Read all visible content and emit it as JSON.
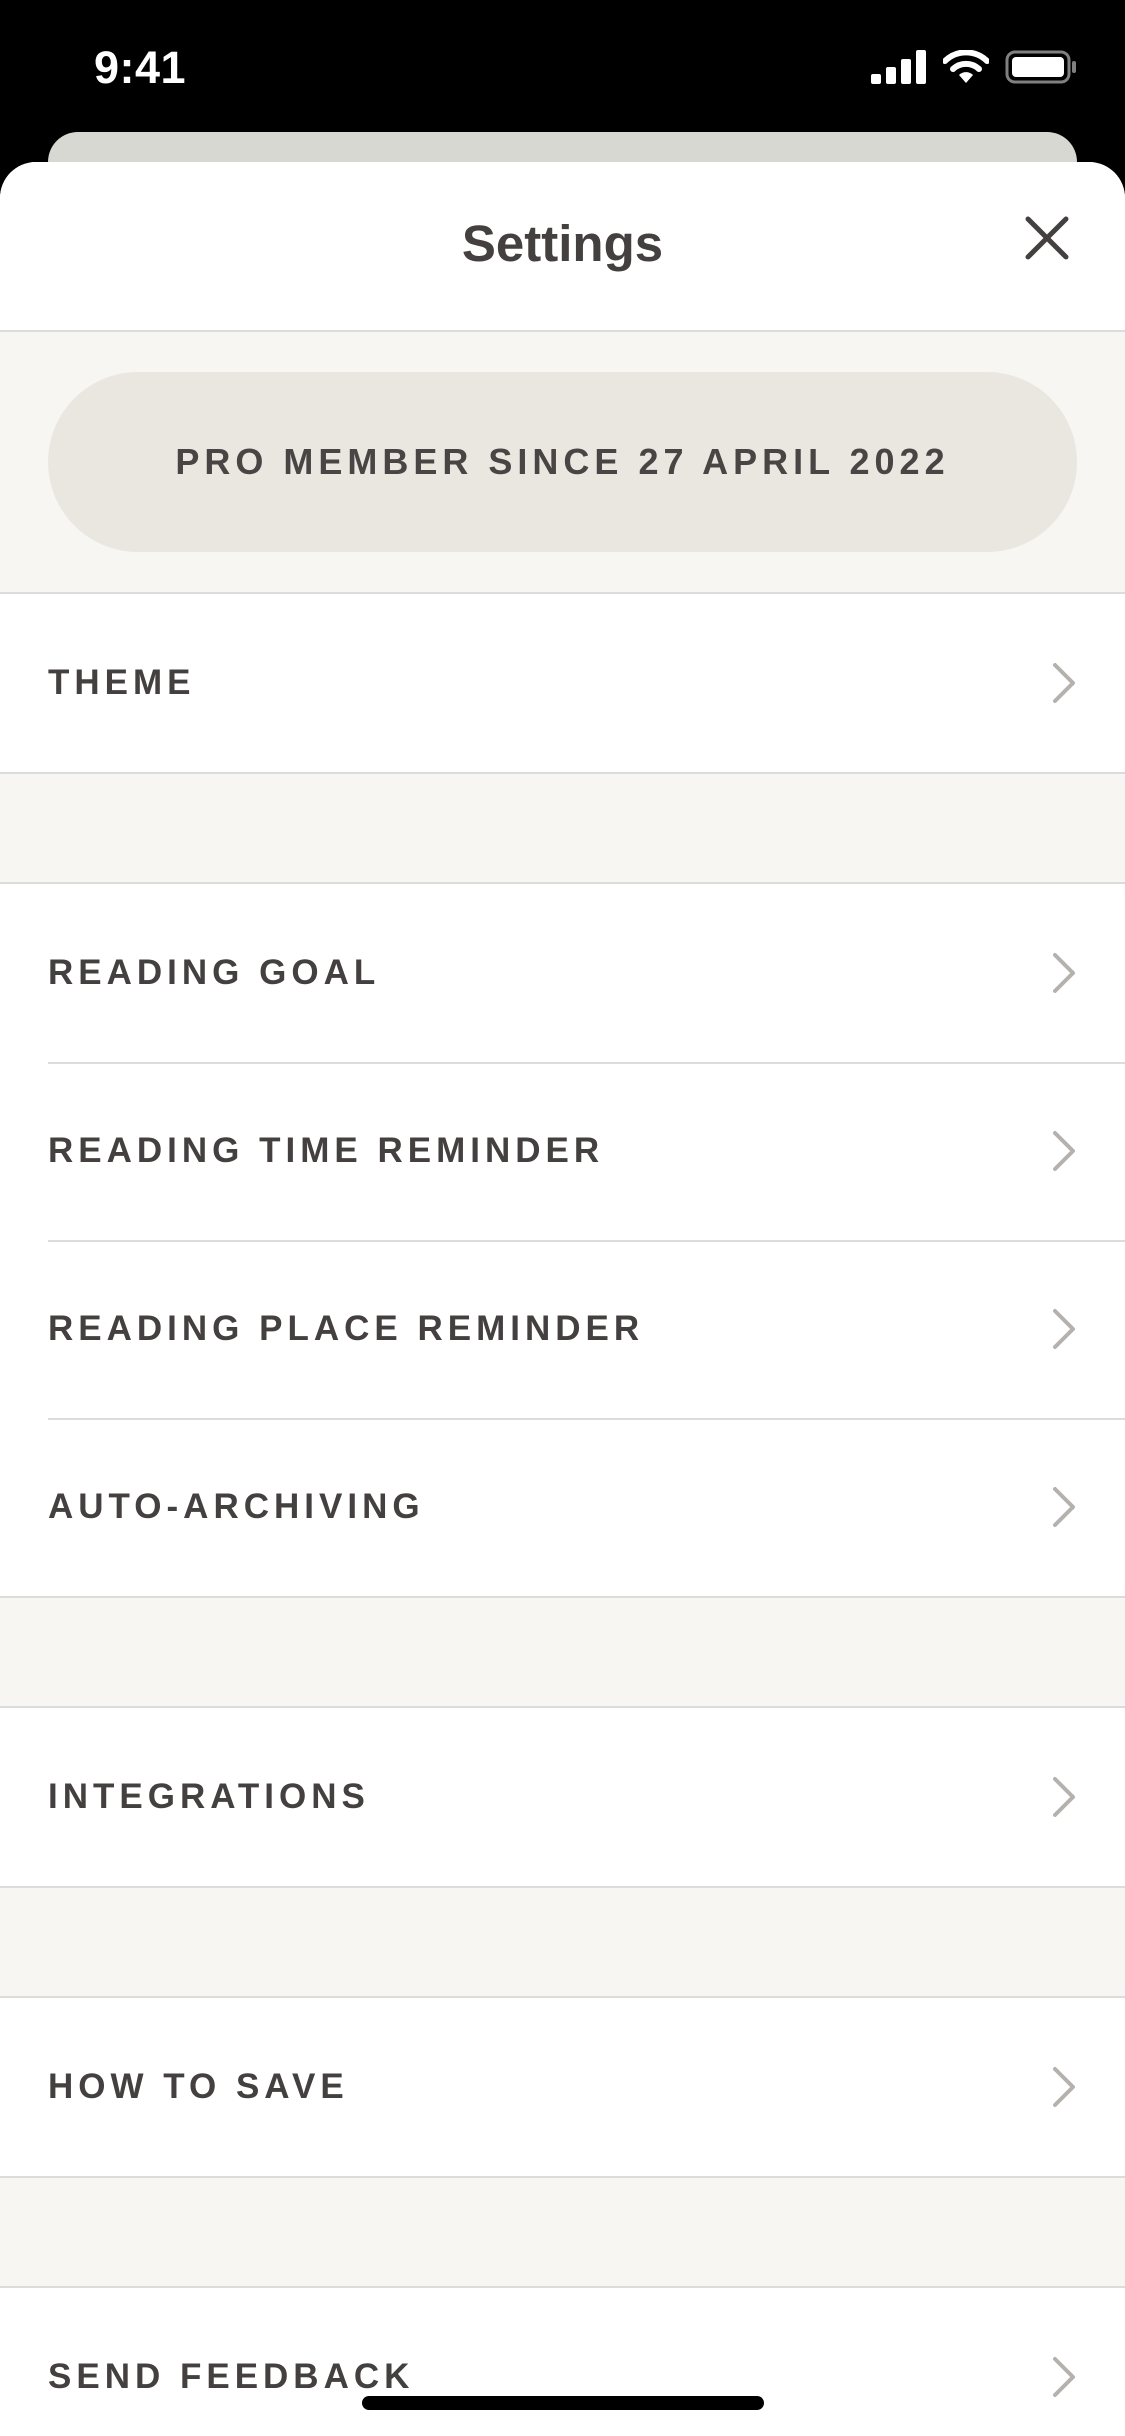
{
  "status_bar": {
    "time": "9:41",
    "icons": [
      "signal-icon",
      "wifi-icon",
      "battery-icon"
    ]
  },
  "header": {
    "title": "Settings",
    "close_icon": "close-icon"
  },
  "membership": {
    "label": "PRO MEMBER SINCE 27 APRIL 2022"
  },
  "groups": [
    {
      "items": [
        {
          "label": "THEME"
        }
      ]
    },
    {
      "items": [
        {
          "label": "READING GOAL"
        },
        {
          "label": "READING TIME REMINDER"
        },
        {
          "label": "READING PLACE REMINDER"
        },
        {
          "label": "AUTO-ARCHIVING"
        }
      ]
    },
    {
      "items": [
        {
          "label": "INTEGRATIONS"
        }
      ]
    },
    {
      "items": [
        {
          "label": "HOW TO SAVE"
        }
      ]
    },
    {
      "items": [
        {
          "label": "SEND FEEDBACK"
        }
      ]
    }
  ],
  "colors": {
    "text": "#454040",
    "background_gap": "#f8f6f2",
    "pill": "#eae6e0",
    "chevron": "#b5b1ad",
    "divider": "#dcdcd8"
  }
}
